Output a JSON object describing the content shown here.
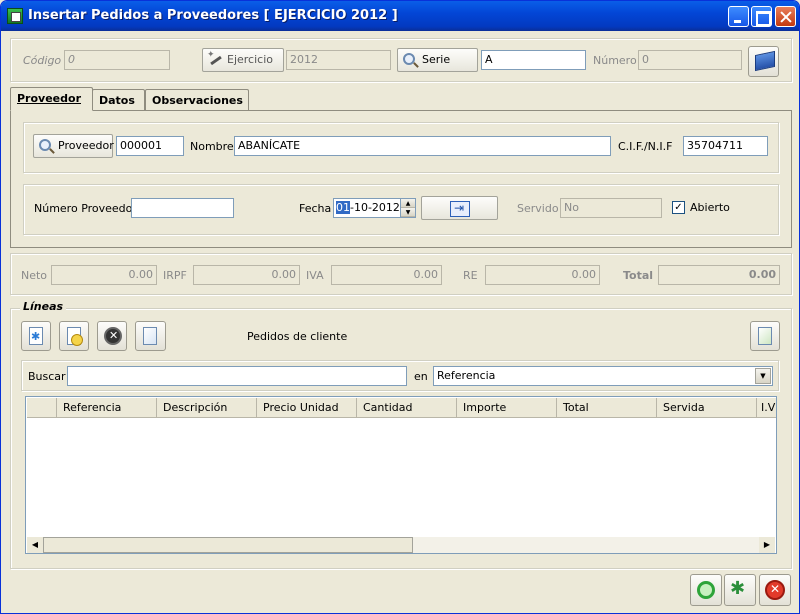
{
  "window": {
    "title": "Insertar Pedidos a Proveedores [ EJERCICIO 2012 ]"
  },
  "header": {
    "codigo_label": "Código",
    "codigo_value": "0",
    "ejercicio_button": "Ejercicio",
    "ejercicio_value": "2012",
    "serie_button": "Serie",
    "serie_value": "A",
    "numero_label": "Número",
    "numero_value": "0"
  },
  "tabs": [
    {
      "label": "Proveedor",
      "active": true
    },
    {
      "label": "Datos",
      "active": false
    },
    {
      "label": "Observaciones",
      "active": false
    }
  ],
  "proveedor": {
    "button": "Proveedor",
    "code": "000001",
    "nombre_label": "Nombre",
    "nombre_value": "ABANÍCATE",
    "cif_label": "C.I.F./N.I.F",
    "cif_value": "35704711",
    "numero_proveedor_label": "Número Proveedor",
    "numero_proveedor_value": "",
    "fecha_label": "Fecha",
    "fecha_day": "01",
    "fecha_rest": "-10-2012",
    "servido_label": "Servido",
    "servido_value": "No",
    "abierto_label": "Abierto",
    "abierto_checked": true
  },
  "totals": {
    "neto_label": "Neto",
    "neto_value": "0.00",
    "irpf_label": "IRPF",
    "irpf_value": "0.00",
    "iva_label": "IVA",
    "iva_value": "0.00",
    "re_label": "RE",
    "re_value": "0.00",
    "total_label": "Total",
    "total_value": "0.00"
  },
  "lineas": {
    "legend": "Líneas",
    "pedidos_label": "Pedidos de cliente",
    "buscar_label": "Buscar",
    "buscar_value": "",
    "en_label": "en",
    "en_value": "Referencia",
    "columns": [
      "Referencia",
      "Descripción",
      "Precio Unidad",
      "Cantidad",
      "Importe",
      "Total",
      "Servida",
      "I.V"
    ]
  },
  "icons": {
    "app": "app-icon",
    "search": "search-icon",
    "wand": "wand-icon",
    "print": "print-icon",
    "calendar": "calendar-icon",
    "add_line": "add-line-icon",
    "edit_line": "edit-line-icon",
    "delete_line": "delete-line-icon",
    "paste_line": "paste-line-icon",
    "new_doc": "new-doc-icon",
    "accept": "accept-icon",
    "save_new": "save-new-icon",
    "cancel": "cancel-icon"
  },
  "colors": {
    "title_bar": "#0346d6",
    "window_bg": "#ece9d8",
    "selection": "#316ac5"
  }
}
